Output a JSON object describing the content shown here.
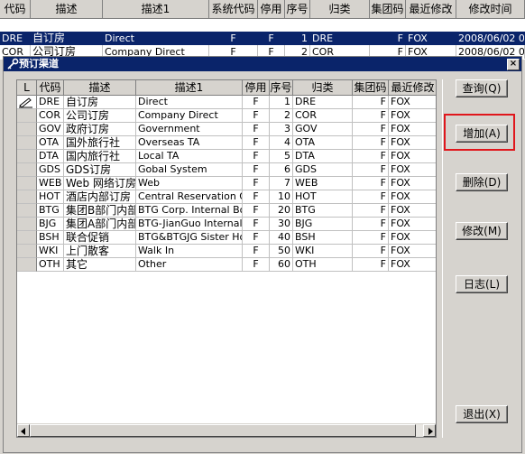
{
  "background_grid": {
    "columns": [
      "代码",
      "描述",
      "描述1",
      "系统代码",
      "停用",
      "序号",
      "归类",
      "集团码",
      "最近修改",
      "修改时间"
    ],
    "rows": [
      {
        "code": "DRE",
        "desc": "自订房",
        "desc1": "Direct",
        "sys": "F",
        "stop": "F",
        "seq": "1",
        "cat": "DRE",
        "group": "F",
        "mod": "FOX",
        "time": "2008/06/02 0"
      },
      {
        "code": "COR",
        "desc": "公司订房",
        "desc1": "Company Direct",
        "sys": "F",
        "stop": "F",
        "seq": "2",
        "cat": "COR",
        "group": "F",
        "mod": "FOX",
        "time": "2008/06/02 0"
      }
    ]
  },
  "dialog": {
    "title": "预订渠道",
    "close_label": "×",
    "grid": {
      "columns": [
        "L",
        "代码",
        "描述",
        "描述1",
        "停用",
        "序号",
        "归类",
        "集团码",
        "最近修改"
      ],
      "rows": [
        {
          "code": "DRE",
          "desc": "自订房",
          "desc1": "Direct",
          "stop": "F",
          "seq": "1",
          "cat": "DRE",
          "group": "F",
          "mod": "FOX"
        },
        {
          "code": "COR",
          "desc": "公司订房",
          "desc1": "Company Direct",
          "stop": "F",
          "seq": "2",
          "cat": "COR",
          "group": "F",
          "mod": "FOX"
        },
        {
          "code": "GOV",
          "desc": "政府订房",
          "desc1": "Government",
          "stop": "F",
          "seq": "3",
          "cat": "GOV",
          "group": "F",
          "mod": "FOX"
        },
        {
          "code": "OTA",
          "desc": "国外旅行社",
          "desc1": "Overseas TA",
          "stop": "F",
          "seq": "4",
          "cat": "OTA",
          "group": "F",
          "mod": "FOX"
        },
        {
          "code": "DTA",
          "desc": "国内旅行社",
          "desc1": "Local TA",
          "stop": "F",
          "seq": "5",
          "cat": "DTA",
          "group": "F",
          "mod": "FOX"
        },
        {
          "code": "GDS",
          "desc": "GDS订房",
          "desc1": "Gobal System",
          "stop": "F",
          "seq": "6",
          "cat": "GDS",
          "group": "F",
          "mod": "FOX"
        },
        {
          "code": "WEB",
          "desc": "Web 网络订房",
          "desc1": "Web",
          "stop": "F",
          "seq": "7",
          "cat": "WEB",
          "group": "F",
          "mod": "FOX"
        },
        {
          "code": "HOT",
          "desc": "酒店内部订房",
          "desc1": "Central Reservation Offic",
          "stop": "F",
          "seq": "10",
          "cat": "HOT",
          "group": "F",
          "mod": "FOX"
        },
        {
          "code": "BTG",
          "desc": "集团B部门内部",
          "desc1": "BTG Corp. Internal Booki",
          "stop": "F",
          "seq": "20",
          "cat": "BTG",
          "group": "F",
          "mod": "FOX"
        },
        {
          "code": "BJG",
          "desc": "集团A部门内部",
          "desc1": "BTG-JianGuo Internal Boo",
          "stop": "F",
          "seq": "30",
          "cat": "BJG",
          "group": "F",
          "mod": "FOX"
        },
        {
          "code": "BSH",
          "desc": "联合促销",
          "desc1": "BTG&BTGJG Sister Hotels",
          "stop": "F",
          "seq": "40",
          "cat": "BSH",
          "group": "F",
          "mod": "FOX"
        },
        {
          "code": "WKI",
          "desc": "上门散客",
          "desc1": "Walk In",
          "stop": "F",
          "seq": "50",
          "cat": "WKI",
          "group": "F",
          "mod": "FOX"
        },
        {
          "code": "OTH",
          "desc": "其它",
          "desc1": "Other",
          "stop": "F",
          "seq": "60",
          "cat": "OTH",
          "group": "F",
          "mod": "FOX"
        }
      ]
    },
    "buttons": {
      "query": "查询(Q)",
      "add": "增加(A)",
      "delete": "删除(D)",
      "modify": "修改(M)",
      "log": "日志(L)",
      "exit": "退出(X)"
    }
  }
}
